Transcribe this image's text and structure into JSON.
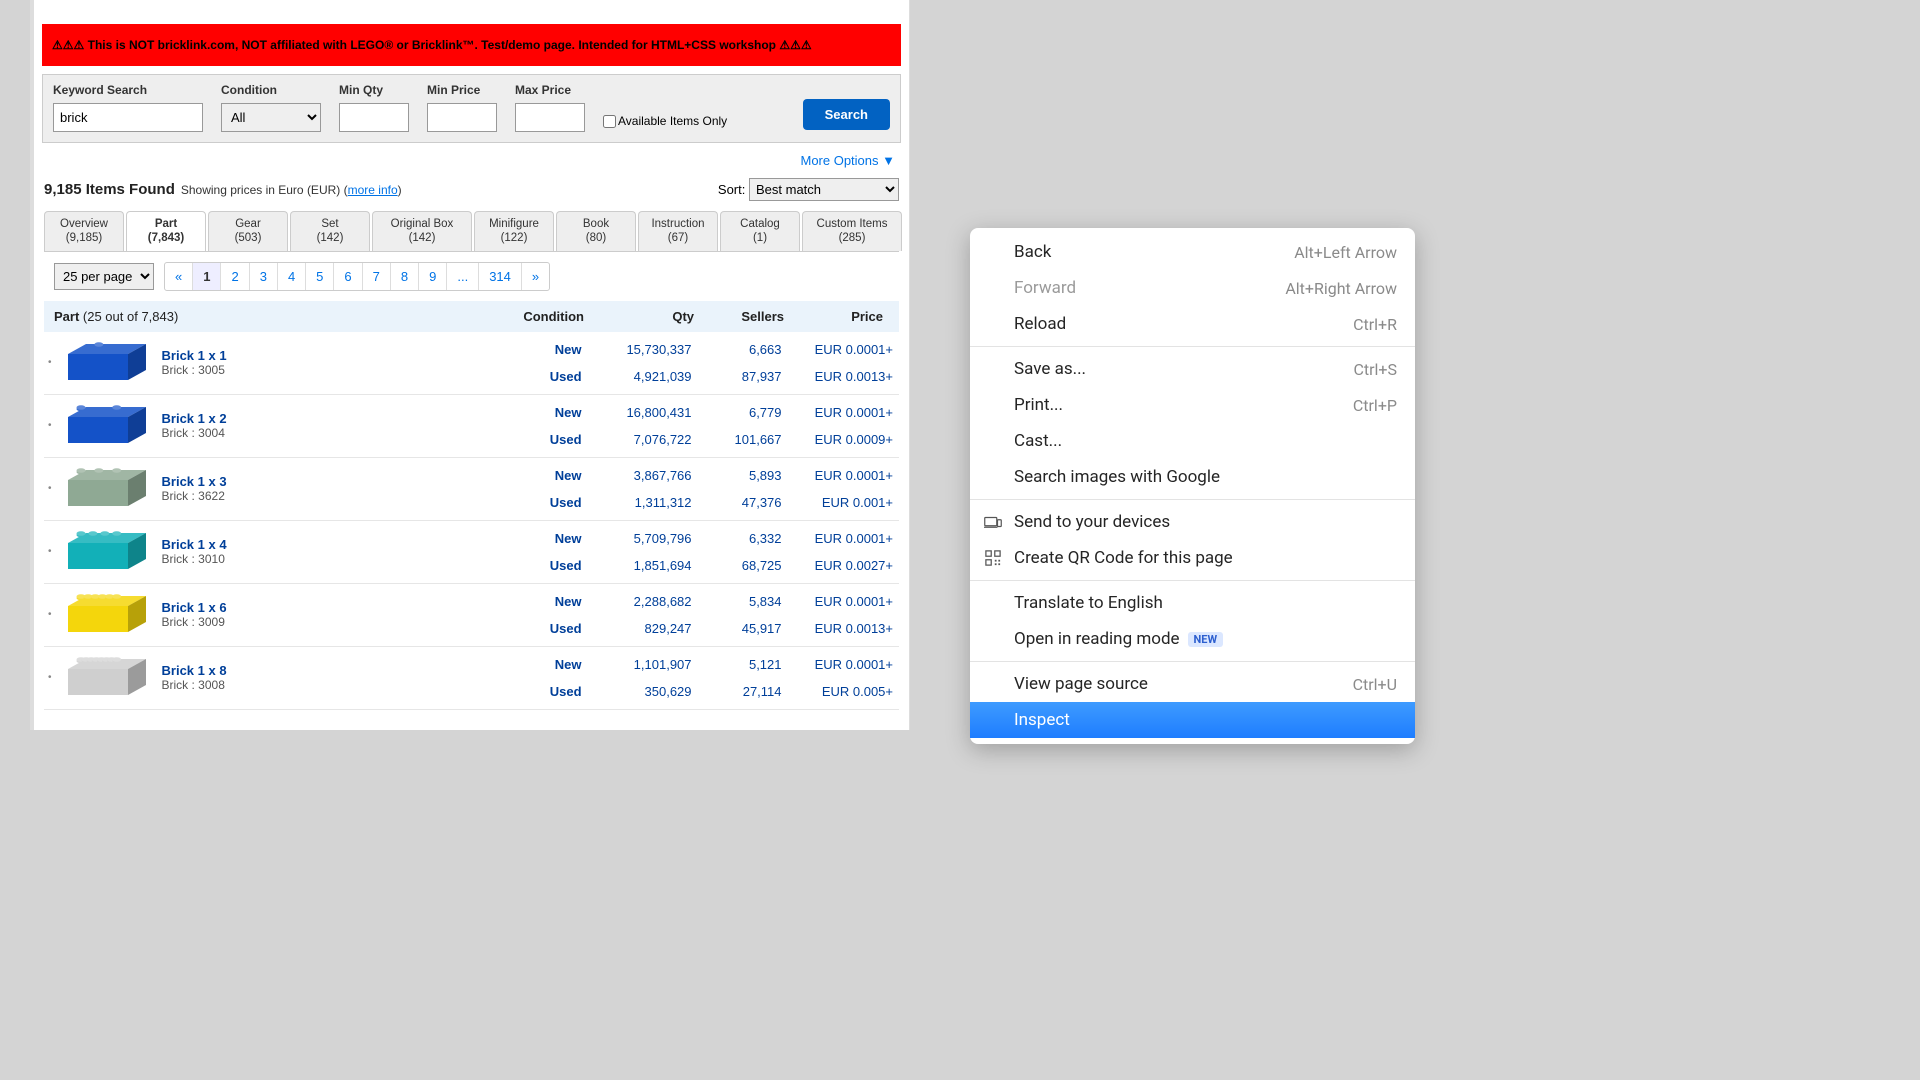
{
  "banner": "⚠⚠⚠ This is NOT bricklink.com, NOT affiliated with LEGO® or Bricklink™. Test/demo page. Intended for HTML+CSS workshop ⚠⚠⚠",
  "search": {
    "kw_label": "Keyword Search",
    "kw_value": "brick",
    "cond_label": "Condition",
    "cond_value": "All",
    "minqty_label": "Min Qty",
    "minprice_label": "Min Price",
    "maxprice_label": "Max Price",
    "avail": "Available Items Only",
    "btn": "Search"
  },
  "more": "More Options ▼",
  "results": {
    "count": "9,185 Items Found",
    "sub_a": "Showing prices in Euro (EUR) (",
    "sub_link": "more info",
    "sub_b": ")"
  },
  "sort": {
    "label": "Sort:",
    "value": "Best match"
  },
  "tabs": [
    {
      "t": "Overview",
      "c": "(9,185)"
    },
    {
      "t": "Part",
      "c": "(7,843)"
    },
    {
      "t": "Gear",
      "c": "(503)"
    },
    {
      "t": "Set",
      "c": "(142)"
    },
    {
      "t": "Original Box",
      "c": "(142)"
    },
    {
      "t": "Minifigure",
      "c": "(122)"
    },
    {
      "t": "Book",
      "c": "(80)"
    },
    {
      "t": "Instruction",
      "c": "(67)"
    },
    {
      "t": "Catalog",
      "c": "(1)"
    },
    {
      "t": "Custom Items",
      "c": "(285)"
    }
  ],
  "perpage": "25 per page",
  "pager": [
    "«",
    "1",
    "2",
    "3",
    "4",
    "5",
    "6",
    "7",
    "8",
    "9",
    "...",
    "314",
    "»"
  ],
  "listhead": {
    "part": "Part",
    "sub": " (25 out of 7,843)",
    "cond": "Condition",
    "qty": "Qty",
    "sellers": "Sellers",
    "price": "Price"
  },
  "rows": [
    {
      "name": "Brick 1 x 1",
      "sub": "Brick : 3005",
      "color": "#1452c8",
      "studs": 1,
      "new": {
        "q": "15,730,337",
        "s": "6,663",
        "p": "EUR 0.0001+"
      },
      "used": {
        "q": "4,921,039",
        "s": "87,937",
        "p": "EUR 0.0013+"
      }
    },
    {
      "name": "Brick 1 x 2",
      "sub": "Brick : 3004",
      "color": "#1452c8",
      "studs": 2,
      "new": {
        "q": "16,800,431",
        "s": "6,779",
        "p": "EUR 0.0001+"
      },
      "used": {
        "q": "7,076,722",
        "s": "101,667",
        "p": "EUR 0.0009+"
      }
    },
    {
      "name": "Brick 1 x 3",
      "sub": "Brick : 3622",
      "color": "#8fa994",
      "studs": 3,
      "new": {
        "q": "3,867,766",
        "s": "5,893",
        "p": "EUR 0.0001+"
      },
      "used": {
        "q": "1,311,312",
        "s": "47,376",
        "p": "EUR 0.001+"
      }
    },
    {
      "name": "Brick 1 x 4",
      "sub": "Brick : 3010",
      "color": "#12b0b8",
      "studs": 4,
      "new": {
        "q": "5,709,796",
        "s": "6,332",
        "p": "EUR 0.0001+"
      },
      "used": {
        "q": "1,851,694",
        "s": "68,725",
        "p": "EUR 0.0027+"
      }
    },
    {
      "name": "Brick 1 x 6",
      "sub": "Brick : 3009",
      "color": "#f4d60c",
      "studs": 6,
      "new": {
        "q": "2,288,682",
        "s": "5,834",
        "p": "EUR 0.0001+"
      },
      "used": {
        "q": "829,247",
        "s": "45,917",
        "p": "EUR 0.0013+"
      }
    },
    {
      "name": "Brick 1 x 8",
      "sub": "Brick : 3008",
      "color": "#cfcfcf",
      "studs": 8,
      "new": {
        "q": "1,101,907",
        "s": "5,121",
        "p": "EUR 0.0001+"
      },
      "used": {
        "q": "350,629",
        "s": "27,114",
        "p": "EUR 0.005+"
      }
    }
  ],
  "cond_labels": {
    "new": "New",
    "used": "Used"
  },
  "ctx": {
    "back": "Back",
    "back_sc": "Alt+Left Arrow",
    "forward": "Forward",
    "forward_sc": "Alt+Right Arrow",
    "reload": "Reload",
    "reload_sc": "Ctrl+R",
    "saveas": "Save as...",
    "saveas_sc": "Ctrl+S",
    "print": "Print...",
    "print_sc": "Ctrl+P",
    "cast": "Cast...",
    "imgsearch": "Search images with Google",
    "send": "Send to your devices",
    "qr": "Create QR Code for this page",
    "translate": "Translate to English",
    "reading": "Open in reading mode",
    "reading_badge": "NEW",
    "source": "View page source",
    "source_sc": "Ctrl+U",
    "inspect": "Inspect"
  }
}
